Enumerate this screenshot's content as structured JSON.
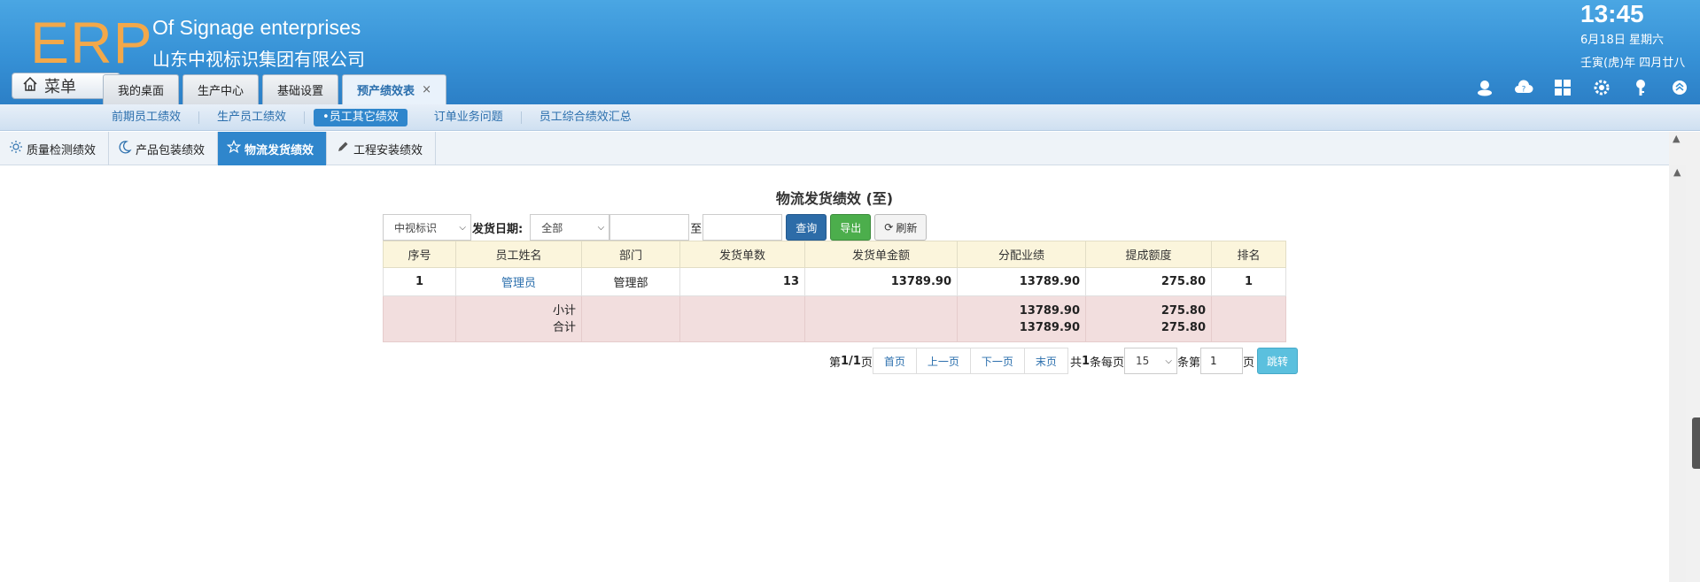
{
  "header": {
    "logo": "ERP",
    "company_en": "Of Signage enterprises",
    "company_cn": "山东中视标识集团有限公司",
    "time": "13:45",
    "date": "6月18日 星期六",
    "lunar": "壬寅(虎)年 四月廿八",
    "menu_label": "菜单"
  },
  "top_tabs": [
    {
      "label": "我的桌面"
    },
    {
      "label": "生产中心"
    },
    {
      "label": "基础设置"
    },
    {
      "label": "预产绩效表",
      "close": "×"
    }
  ],
  "header_icons": [
    "user-icon",
    "help-cloud-icon",
    "apps-icon",
    "gear-icon",
    "key-icon",
    "collapse-icon"
  ],
  "subnav": [
    {
      "label": "前期员工绩效"
    },
    {
      "label": "生产员工绩效"
    },
    {
      "label": "•员工其它绩效"
    },
    {
      "label": "订单业务问题"
    },
    {
      "label": "员工综合绩效汇总"
    }
  ],
  "tabs2": [
    {
      "label": "质量检测绩效",
      "icon": "sun-icon"
    },
    {
      "label": "产品包装绩效",
      "icon": "moon-icon"
    },
    {
      "label": "物流发货绩效",
      "icon": "star-icon"
    },
    {
      "label": "工程安装绩效",
      "icon": "pencil-icon"
    }
  ],
  "page": {
    "title": "物流发货绩效 (至)"
  },
  "filters": {
    "company_select": "中视标识",
    "date_label": "发货日期:",
    "range_select": "全部",
    "date_from": "",
    "to_label": "至",
    "date_to": "",
    "query_btn": "查询",
    "export_btn": "导出",
    "refresh_btn": "刷新"
  },
  "table": {
    "columns": [
      "序号",
      "员工姓名",
      "部门",
      "发货单数",
      "发货单金额",
      "分配业绩",
      "提成额度",
      "排名"
    ],
    "rows": [
      {
        "no": "1",
        "name": "管理员",
        "dept": "管理部",
        "count": "13",
        "amount": "13789.90",
        "perf": "13789.90",
        "commission": "275.80",
        "rank": "1"
      }
    ],
    "subtotal": {
      "label": "小计",
      "perf": "13789.90",
      "commission": "275.80"
    },
    "total": {
      "label": "合计",
      "perf": "13789.90",
      "commission": "275.80"
    }
  },
  "pager": {
    "page_prefix": "第",
    "page_info": "1/1",
    "page_suffix": "页",
    "first": "首页",
    "prev": "上一页",
    "next": "下一页",
    "last": "末页",
    "total_prefix": "共",
    "total_count": "1",
    "per_page_label": "条每页",
    "per_page": "15",
    "goto_prefix": "条第",
    "goto_page": "1",
    "goto_suffix": "页",
    "jump_btn": "跳转"
  },
  "colors": {
    "header_blue": "#3691d6",
    "logo_orange": "#f2a84a",
    "accent_blue": "#2f86cc",
    "table_head": "#fbf5dc",
    "summary_row": "#f2dede"
  }
}
